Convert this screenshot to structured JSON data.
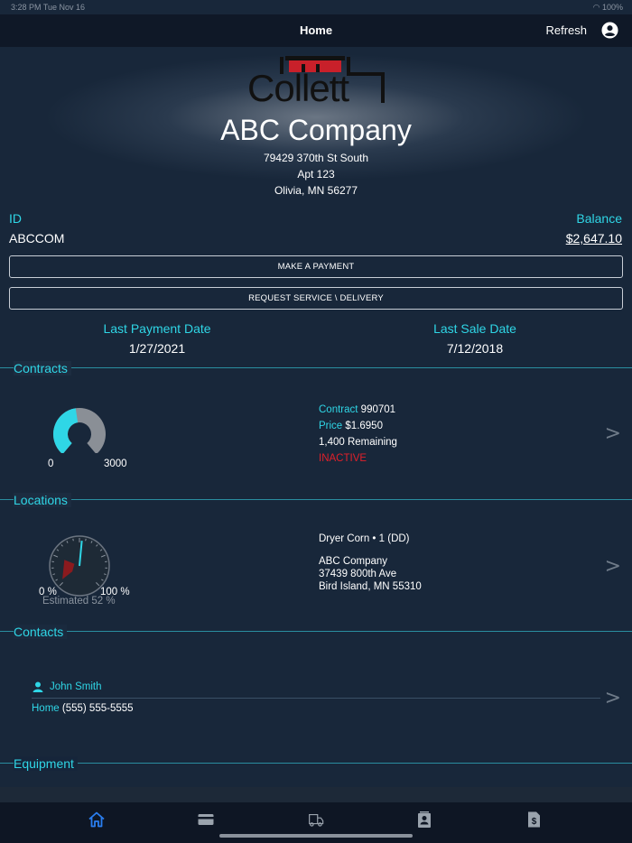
{
  "statusbar": {
    "time": "3:28 PM   Tue Nov 16",
    "battery": "100%"
  },
  "nav": {
    "title": "Home",
    "refresh": "Refresh"
  },
  "company": {
    "name": "ABC Company",
    "address1": "79429 370th St South",
    "address2": "Apt 123",
    "address3": "Olivia, MN 56277"
  },
  "account": {
    "id_label": "ID",
    "id_value": "ABCCOM",
    "balance_label": "Balance",
    "balance_value": "$2,647.10"
  },
  "buttons": {
    "payment": "MAKE A PAYMENT",
    "service": "REQUEST SERVICE \\ DELIVERY"
  },
  "dates": {
    "last_payment_label": "Last Payment Date",
    "last_payment_value": "1/27/2021",
    "last_sale_label": "Last Sale Date",
    "last_sale_value": "7/12/2018"
  },
  "contracts": {
    "title": "Contracts",
    "gauge_min": "0",
    "gauge_max": "3000",
    "gauge_fill_fraction": 0.47,
    "contract_label": "Contract",
    "contract_value": "990701",
    "price_label": "Price",
    "price_value": "$1.6950",
    "remaining": "1,400 Remaining",
    "status": "INACTIVE"
  },
  "locations": {
    "title": "Locations",
    "gauge_min": "0 %",
    "gauge_max": "100 %",
    "estimated": "Estimated 52 %",
    "estimated_fraction": 0.52,
    "tank": "Dryer Corn • 1 (DD)",
    "name": "ABC Company",
    "street": "37439 800th Ave",
    "city": "Bird Island, MN  55310"
  },
  "contacts": {
    "title": "Contacts",
    "name": "John Smith",
    "phone_label": "Home",
    "phone_value": "(555) 555-5555"
  },
  "equipment": {
    "title": "Equipment"
  },
  "colors": {
    "accent": "#2fd6e6",
    "alert": "#e0202a",
    "tab_active": "#2a7ef0",
    "brand_red": "#c8202a"
  }
}
